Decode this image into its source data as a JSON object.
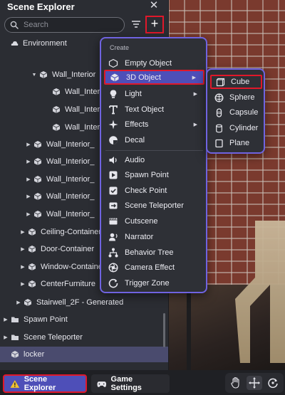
{
  "panel": {
    "title": "Scene Explorer",
    "close_glyph": "✕",
    "search_placeholder": "Search",
    "add_glyph": "+"
  },
  "tree": [
    {
      "label": "Environment",
      "icon": "environment-icon",
      "expanded": false,
      "selected": false
    },
    {
      "label": "Wall_Interior",
      "icon": "object-icon",
      "expanded": true,
      "selected": false
    },
    {
      "label": "Wall_Interior",
      "icon": "object-icon",
      "expanded": false,
      "selected": false
    },
    {
      "label": "Wall_Interior",
      "icon": "object-icon",
      "expanded": false,
      "selected": false
    },
    {
      "label": "Wall_Interior",
      "icon": "object-icon",
      "expanded": false,
      "selected": false
    },
    {
      "label": "Wall_Interior_",
      "icon": "object-icon",
      "expanded": false,
      "selected": false
    },
    {
      "label": "Wall_Interior_",
      "icon": "object-icon",
      "expanded": false,
      "selected": false
    },
    {
      "label": "Wall_Interior_",
      "icon": "object-icon",
      "expanded": false,
      "selected": false
    },
    {
      "label": "Wall_Interior_",
      "icon": "object-icon",
      "expanded": false,
      "selected": false
    },
    {
      "label": "Wall_Interior_",
      "icon": "object-icon",
      "expanded": false,
      "selected": false
    },
    {
      "label": "Ceiling-Container",
      "icon": "object-icon",
      "expanded": false,
      "selected": false
    },
    {
      "label": "Door-Container",
      "icon": "object-icon",
      "expanded": false,
      "selected": false
    },
    {
      "label": "Window-Container",
      "icon": "object-icon",
      "expanded": false,
      "selected": false
    },
    {
      "label": "CenterFurniture",
      "icon": "object-icon",
      "expanded": false,
      "selected": false
    },
    {
      "label": "Stairwell_2F - Generated",
      "icon": "object-icon",
      "expanded": false,
      "selected": false
    },
    {
      "label": "Spawn Point",
      "icon": "folder-icon",
      "expanded": false,
      "selected": false
    },
    {
      "label": "Scene Teleporter",
      "icon": "folder-icon",
      "expanded": false,
      "selected": false
    },
    {
      "label": "locker",
      "icon": "object-icon",
      "expanded": false,
      "selected": true
    }
  ],
  "create_menu": {
    "header": "Create",
    "items": [
      {
        "label": "Empty Object",
        "icon": "empty-object-icon",
        "submenu": false
      },
      {
        "label": "3D Object",
        "icon": "cube-icon",
        "submenu": true,
        "active": true
      },
      {
        "label": "Light",
        "icon": "bulb-icon",
        "submenu": true
      },
      {
        "label": "Text Object",
        "icon": "text-icon",
        "submenu": false
      },
      {
        "label": "Effects",
        "icon": "sparkle-icon",
        "submenu": true
      },
      {
        "label": "Decal",
        "icon": "decal-icon",
        "submenu": false
      },
      {
        "label": "Audio",
        "icon": "audio-icon",
        "submenu": false
      },
      {
        "label": "Spawn Point",
        "icon": "spawn-point-icon",
        "submenu": false
      },
      {
        "label": "Check Point",
        "icon": "check-point-icon",
        "submenu": false
      },
      {
        "label": "Scene Teleporter",
        "icon": "teleporter-icon",
        "submenu": false
      },
      {
        "label": "Cutscene",
        "icon": "cutscene-icon",
        "submenu": false
      },
      {
        "label": "Narrator",
        "icon": "narrator-icon",
        "submenu": false
      },
      {
        "label": "Behavior Tree",
        "icon": "behavior-tree-icon",
        "submenu": false
      },
      {
        "label": "Camera Effect",
        "icon": "camera-effect-icon",
        "submenu": false
      },
      {
        "label": "Trigger Zone",
        "icon": "trigger-zone-icon",
        "submenu": false
      }
    ],
    "submenu_glyph": "▶"
  },
  "object_submenu": {
    "items": [
      {
        "label": "Cube",
        "icon": "cube-outline-icon",
        "highlighted": true
      },
      {
        "label": "Sphere",
        "icon": "sphere-icon"
      },
      {
        "label": "Capsule",
        "icon": "capsule-icon"
      },
      {
        "label": "Cylinder",
        "icon": "cylinder-icon"
      },
      {
        "label": "Plane",
        "icon": "plane-icon"
      }
    ]
  },
  "bottom_bar": {
    "tabs": [
      {
        "label": "Scene Explorer",
        "icon": "warning-icon",
        "active": true
      },
      {
        "label": "Game Settings",
        "icon": "gamepad-icon",
        "active": false
      }
    ],
    "tools": [
      {
        "icon": "hand-icon",
        "active": false
      },
      {
        "icon": "move-icon",
        "active": true
      },
      {
        "icon": "rotate-icon",
        "active": false
      }
    ]
  },
  "colors": {
    "accent": "#4e4fb8",
    "menu_border": "#6f63e0",
    "highlight_red": "#e0182a",
    "panel_bg": "#2b2d33"
  }
}
